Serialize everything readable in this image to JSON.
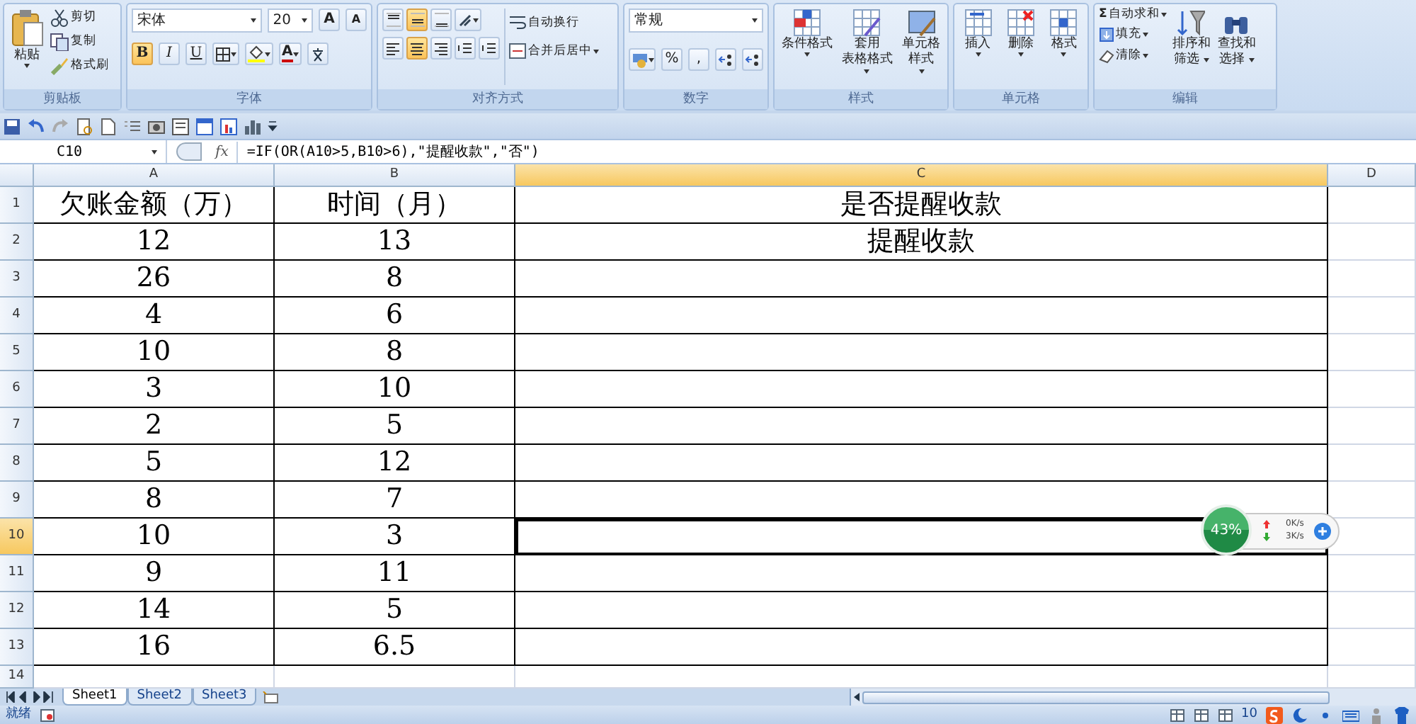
{
  "ribbon": {
    "clipboard": {
      "title": "剪贴板",
      "paste": "粘贴",
      "commands": [
        "剪切",
        "复制",
        "格式刷"
      ]
    },
    "font": {
      "title": "字体",
      "font_name": "宋体",
      "font_size": "20",
      "grow": "A",
      "shrink": "A",
      "styles": [
        {
          "label": "B",
          "kind": "bold",
          "on": true
        },
        {
          "label": "I",
          "kind": "italic",
          "on": false
        },
        {
          "label": "U",
          "kind": "underline",
          "on": false
        }
      ],
      "font_color": "A"
    },
    "alignment": {
      "title": "对齐方式",
      "vertical": [
        {
          "selected": false
        },
        {
          "selected": true
        },
        {
          "selected": false
        }
      ],
      "horizontal": [
        {
          "selected": false
        },
        {
          "selected": true
        },
        {
          "selected": false
        }
      ],
      "wrap": "自动换行",
      "merge": "合并后居中"
    },
    "number": {
      "title": "数字",
      "format": "常规",
      "percent": "%",
      "comma": ","
    },
    "styles": {
      "title": "样式",
      "commands": [
        [
          "条件格式"
        ],
        [
          "套用",
          "表格格式"
        ],
        [
          "单元格",
          "样式"
        ]
      ]
    },
    "cells": {
      "title": "单元格",
      "commands": [
        "插入",
        "删除",
        "格式"
      ]
    },
    "editing": {
      "title": "编辑",
      "sigma": "Σ",
      "small": [
        "自动求和",
        "填充",
        "清除"
      ],
      "large": [
        [
          "排序和",
          "筛选"
        ],
        [
          "查找和",
          "选择"
        ]
      ]
    }
  },
  "formula_bar": {
    "name_box": "C10",
    "fx": "fx",
    "formula": "=IF(OR(A10>5,B10>6),\"提醒收款\",\"否\")"
  },
  "sheet": {
    "columns": [
      {
        "label": "A",
        "selected": false
      },
      {
        "label": "B",
        "selected": false
      },
      {
        "label": "C",
        "selected": true
      },
      {
        "label": "D",
        "selected": false
      }
    ],
    "rows": [
      {
        "header": "1",
        "selected": false,
        "cells": [
          "欠账金额（万）",
          "时间（月）",
          "是否提醒收款"
        ]
      },
      {
        "header": "2",
        "selected": false,
        "cells": [
          "12",
          "13",
          "提醒收款"
        ]
      },
      {
        "header": "3",
        "selected": false,
        "cells": [
          "26",
          "8",
          ""
        ]
      },
      {
        "header": "4",
        "selected": false,
        "cells": [
          "4",
          "6",
          ""
        ]
      },
      {
        "header": "5",
        "selected": false,
        "cells": [
          "10",
          "8",
          ""
        ]
      },
      {
        "header": "6",
        "selected": false,
        "cells": [
          "3",
          "10",
          ""
        ]
      },
      {
        "header": "7",
        "selected": false,
        "cells": [
          "2",
          "5",
          ""
        ]
      },
      {
        "header": "8",
        "selected": false,
        "cells": [
          "5",
          "12",
          ""
        ]
      },
      {
        "header": "9",
        "selected": false,
        "cells": [
          "8",
          "7",
          ""
        ]
      },
      {
        "header": "10",
        "selected": true,
        "cells": [
          "10",
          "3",
          ""
        ]
      },
      {
        "header": "11",
        "selected": false,
        "cells": [
          "9",
          "11",
          ""
        ]
      },
      {
        "header": "12",
        "selected": false,
        "cells": [
          "14",
          "5",
          ""
        ]
      },
      {
        "header": "13",
        "selected": false,
        "cells": [
          "16",
          "6.5",
          ""
        ]
      },
      {
        "header": "14",
        "selected": false
      }
    ]
  },
  "sheet_tabs": [
    {
      "label": "Sheet1",
      "selected": true
    },
    {
      "label": "Sheet2",
      "selected": false
    },
    {
      "label": "Sheet3",
      "selected": false
    }
  ],
  "status_bar": {
    "status": "就绪",
    "zoom": "10"
  },
  "speed_widget": {
    "percent": "43%",
    "upload": "0K/s",
    "download": "3K/s"
  }
}
